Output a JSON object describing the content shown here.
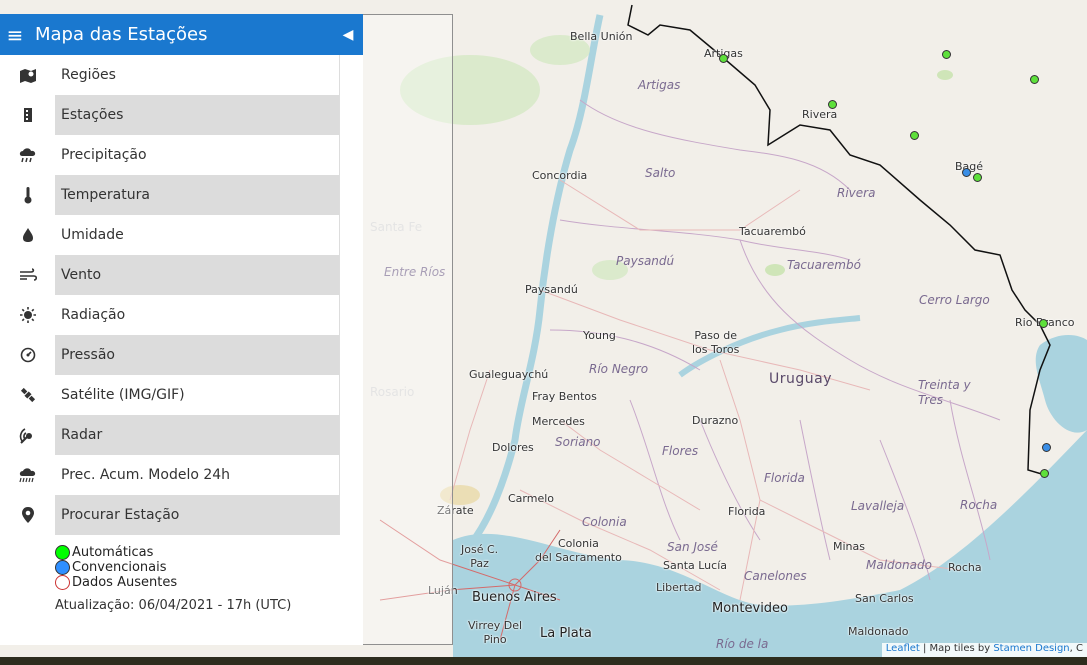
{
  "panel": {
    "title": "Mapa das Estações",
    "menu": [
      {
        "label": "Regiões",
        "icon": "map-pin-icon"
      },
      {
        "label": "Estações",
        "icon": "building-icon"
      },
      {
        "label": "Precipitação",
        "icon": "rain-cloud-icon"
      },
      {
        "label": "Temperatura",
        "icon": "thermometer-icon"
      },
      {
        "label": "Umidade",
        "icon": "droplet-icon"
      },
      {
        "label": "Vento",
        "icon": "wind-icon"
      },
      {
        "label": "Radiação",
        "icon": "sun-icon"
      },
      {
        "label": "Pressão",
        "icon": "gauge-icon"
      },
      {
        "label": "Satélite (IMG/GIF)",
        "icon": "satellite-icon"
      },
      {
        "label": "Radar",
        "icon": "radar-icon"
      },
      {
        "label": "Prec. Acum. Modelo 24h",
        "icon": "rain-cloud-icon"
      },
      {
        "label": "Procurar Estação",
        "icon": "location-icon"
      }
    ],
    "legend": {
      "automatic": "Automáticas",
      "conventional": "Convencionais",
      "absent": "Dados Ausentes"
    },
    "updated": "Atualização: 06/04/2021 - 17h (UTC)"
  },
  "map": {
    "country": "Uruguay",
    "cities": {
      "bella_union": "Bella Unión",
      "artigas_city": "Artigas",
      "rivera_city": "Rivera",
      "bage": "Bagé",
      "concordia": "Concordia",
      "tacuarembo_city": "Tacuarembó",
      "paysandu_city": "Paysandú",
      "young": "Young",
      "paso_de_los_toros": "Paso de\nlos Toros",
      "rio_branco": "Rio Branco",
      "gualeguaychu": "Gualeguaychú",
      "fray_bentos": "Fray Bentos",
      "mercedes": "Mercedes",
      "durazno": "Durazno",
      "dolores": "Dolores",
      "carmelo": "Carmelo",
      "zarate": "Zárate",
      "colonia_city": "Colonia\ndel Sacramento",
      "florida_city": "Florida",
      "minas": "Minas",
      "jose_c_paz": "José C.\nPaz",
      "santa_lucia": "Santa Lucía",
      "lujan": "Luján",
      "libertad": "Libertad",
      "rocha_city": "Rocha",
      "buenos_aires": "Buenos Aires",
      "montevideo": "Montevideo",
      "san_carlos": "San Carlos",
      "virrey_del_pino": "Virrey Del\nPino",
      "la_plata": "La Plata",
      "maldonado_city": "Maldonado"
    },
    "departments": {
      "artigas": "Artigas",
      "salto": "Salto",
      "rivera": "Rivera",
      "entre_rios": "Entre Ríos",
      "paysandu": "Paysandú",
      "tacuarembo": "Tacuarembó",
      "cerro_largo": "Cerro Largo",
      "rio_negro": "Río Negro",
      "treinta_y_tres": "Treinta y\nTres",
      "soriano": "Soriano",
      "flores": "Flores",
      "florida": "Florida",
      "lavalleja": "Lavalleja",
      "rocha": "Rocha",
      "colonia": "Colonia",
      "san_jose": "San José",
      "canelones": "Canelones",
      "maldonado": "Maldonado",
      "rio_de_la": "Río de la"
    },
    "colors": {
      "automatic": "#5ee03b",
      "conventional": "#3a8ee6",
      "water": "#aad3df",
      "land": "#f2efe9",
      "header": "#1a78cf"
    }
  },
  "attribution": {
    "leaflet": "Leaflet",
    "sep": " | Map tiles by ",
    "stamen": "Stamen Design",
    "tail": ", C"
  }
}
